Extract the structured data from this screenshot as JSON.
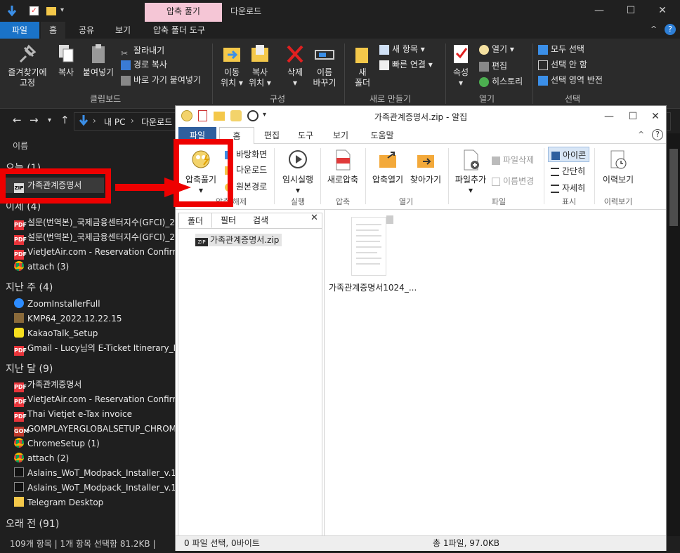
{
  "explorer": {
    "context_tab": "압축 풀기",
    "window_title": "다운로드",
    "menu": {
      "file": "파일",
      "home": "홈",
      "share": "공유",
      "view": "보기",
      "tools": "압축 폴더 도구"
    },
    "ribbon": {
      "pin": "즐겨찾기에\n고정",
      "copy": "복사",
      "paste": "붙여넣기",
      "cut": "잘라내기",
      "copy_path": "경로 복사",
      "paste_shortcut": "바로 가기 붙여넣기",
      "clipboard_group": "클립보드",
      "move_to": "이동\n위치 ▾",
      "copy_to": "복사\n위치 ▾",
      "delete": "삭제\n▾",
      "rename": "이름\n바꾸기",
      "organize_group": "구성",
      "new_folder": "새\n폴더",
      "new_item": "새 항목 ▾",
      "easy_access": "빠른 연결 ▾",
      "new_group": "새로 만들기",
      "properties": "속성\n▾",
      "open": "열기 ▾",
      "edit": "편집",
      "history": "히스토리",
      "open_group": "열기",
      "select_all": "모두 선택",
      "select_none": "선택 안 함",
      "invert_selection": "선택 영역 반전",
      "select_group": "선택"
    },
    "address": {
      "this_pc": "내 PC",
      "downloads": "다운로드"
    },
    "column_header": "이름",
    "groups": [
      {
        "label": "오늘 (1)"
      },
      {
        "label": "이제 (4)"
      },
      {
        "label": "지난 주 (4)"
      },
      {
        "label": "지난 달 (9)"
      },
      {
        "label": "오래 전 (91)"
      }
    ],
    "today_items": [
      "가족관계증명서"
    ],
    "yesterday_items": [
      "설문(번역본)_국제금융센터지수(GFCI)_2",
      "설문(번역본)_국제금융센터지수(GFCI)_2",
      "VietJetAir.com - Reservation Confirmec",
      "attach (3)"
    ],
    "last_week_items": [
      "ZoomInstallerFull",
      "KMP64_2022.12.22.15",
      "KakaoTalk_Setup",
      "Gmail - Lucy님의 E-Ticket Itinerary_Rec"
    ],
    "last_month_items": [
      "가족관계증명서",
      "VietJetAir.com - Reservation Confirmec",
      "Thai Vietjet e-Tax invoice",
      "GOMPLAYERGLOBALSETUP_CHROME",
      "ChromeSetup (1)",
      "attach (2)",
      "Aslains_WoT_Modpack_Installer_v.1.19.0",
      "Aslains_WoT_Modpack_Installer_v.1.19.0",
      "Telegram Desktop"
    ],
    "status": "109개 항목  |  1개 항목 선택함 81.2KB  |"
  },
  "alzip": {
    "title": "가족관계증명서.zip - 알집",
    "tabs": {
      "file": "파일",
      "home": "홈",
      "edit": "편집",
      "tools": "도구",
      "view": "보기",
      "help": "도움말"
    },
    "ribbon": {
      "extract": "압축풀기\n▾",
      "to_desktop": "바탕화면",
      "to_downloads": "다운로드",
      "to_source": "원본경로",
      "extract_group": "압축 해제",
      "temp_run": "임시실행\n▾",
      "run_group": "실행",
      "new_zip": "새로압축",
      "zip_group": "압축",
      "open_zip": "압축열기",
      "goto": "찾아가기",
      "open_group": "열기",
      "add_file": "파일추가\n▾",
      "delete_file": "파일삭제",
      "rename": "이름변경",
      "file_group": "파일",
      "view_icon": "아이콘",
      "view_simple": "간단히",
      "view_detail": "자세히",
      "view_group": "표시",
      "history": "이력보기",
      "history_group": "이력보기"
    },
    "left_tabs": {
      "folder": "폴더",
      "filter": "필터",
      "search": "검색"
    },
    "tree_item": "가족관계증명서.zip",
    "file_name": "가족관계증명서1024_...",
    "status_left": "0 파일 선택,  0바이트",
    "status_right": "총 1파일,  97.0KB"
  }
}
